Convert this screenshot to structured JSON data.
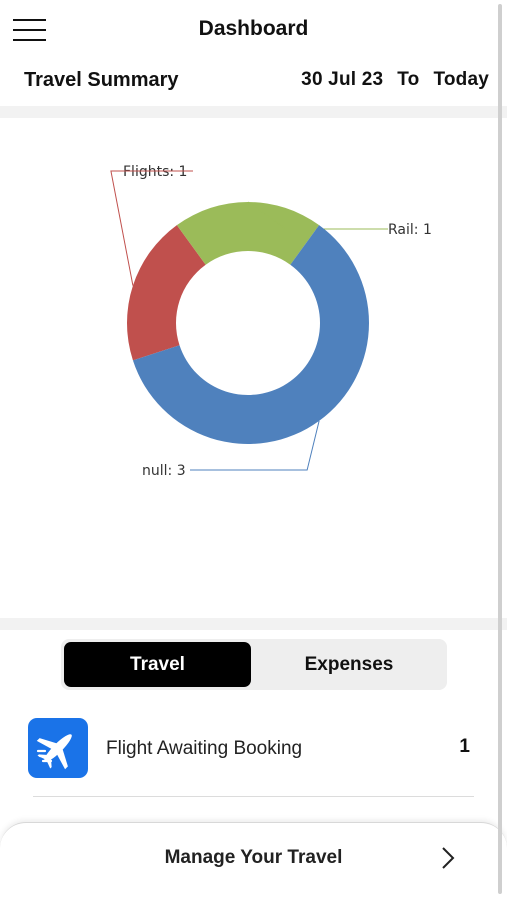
{
  "header": {
    "title": "Dashboard",
    "menu_icon": "hamburger-menu-icon"
  },
  "summary": {
    "title": "Travel Summary",
    "from_date": "30 Jul 23",
    "to_label": "To",
    "to_date": "Today"
  },
  "chart_data": {
    "type": "pie",
    "style": "donut",
    "categories": [
      "Flights",
      "Rail",
      "null"
    ],
    "values": [
      1,
      1,
      3
    ],
    "colors": [
      "#c0504d",
      "#9bbb59",
      "#4f81bd"
    ],
    "labels": [
      "Flights: 1",
      "Rail: 1",
      "null: 3"
    ],
    "legend": "none"
  },
  "tabs": {
    "travel": "Travel",
    "expenses": "Expenses",
    "active": "Travel"
  },
  "list": {
    "items": [
      {
        "label": "Flight Awaiting Booking",
        "count": "1",
        "icon": "airplane-icon",
        "icon_color": "#1a73e8"
      }
    ]
  },
  "footer": {
    "label": "Manage Your Travel",
    "icon": "chevron-right-icon"
  }
}
